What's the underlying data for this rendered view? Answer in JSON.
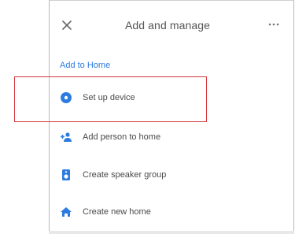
{
  "header": {
    "title": "Add and manage",
    "close_icon": "close-icon",
    "more_icon": "more-horizontal-icon"
  },
  "section": {
    "title": "Add to Home"
  },
  "items": [
    {
      "label": "Set up device",
      "icon": "device-setup-icon",
      "highlighted": true
    },
    {
      "label": "Add person to home",
      "icon": "add-person-icon",
      "highlighted": false
    },
    {
      "label": "Create speaker group",
      "icon": "speaker-group-icon",
      "highlighted": false
    },
    {
      "label": "Create new home",
      "icon": "home-icon",
      "highlighted": false
    }
  ],
  "colors": {
    "accent": "#2d7be0",
    "highlight_border": "#d3373c",
    "text": "#4a4a4a"
  }
}
